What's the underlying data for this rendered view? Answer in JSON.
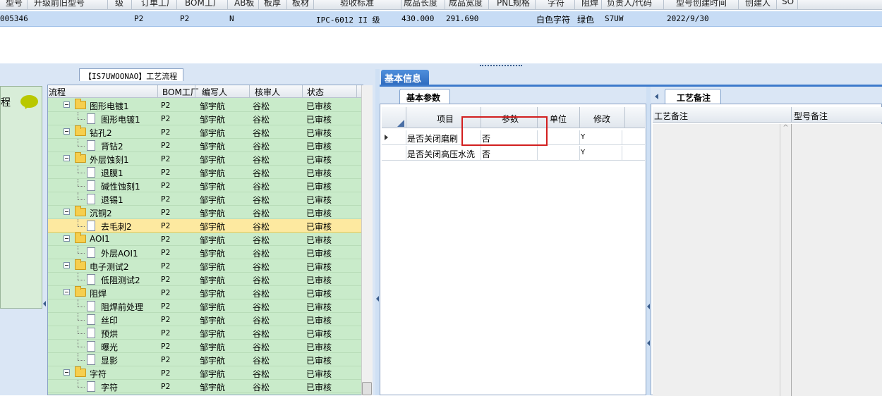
{
  "top_grid": {
    "columns": [
      "型号",
      "升级前旧型号",
      "级",
      "订单工厂",
      "BOM工厂",
      "AB板",
      "板厚",
      "板材",
      "验收标准",
      "成品长度",
      "成品宽度",
      "PNL规格",
      "字符",
      "阻焊",
      "负责人/代码",
      "型号创建时间",
      "创建人",
      "SO"
    ],
    "row": {
      "id": "005346",
      "order_factory": "P2",
      "bom_factory": "P2",
      "ab": "N",
      "standard": "IPC-6012 II 级",
      "length": "430.000",
      "width": "291.690",
      "char": "白色字符",
      "mask": "绿色",
      "code": "S7UW",
      "created": "2022/9/30"
    }
  },
  "left_panel": {
    "tab_title": "【IS7UWOONAO】工艺流程",
    "side_label": "程",
    "tree_columns": [
      "流程",
      "BOM工厂",
      "编写人",
      "核审人",
      "状态"
    ],
    "rows": [
      {
        "level": 0,
        "type": "folder",
        "name": "图形电镀1",
        "bom": "P2",
        "writer": "邹宇航",
        "reviewer": "谷松",
        "status": "已审核"
      },
      {
        "level": 1,
        "type": "doc",
        "name": "图形电镀1",
        "bom": "P2",
        "writer": "邹宇航",
        "reviewer": "谷松",
        "status": "已审核"
      },
      {
        "level": 0,
        "type": "folder",
        "name": "钻孔2",
        "bom": "P2",
        "writer": "邹宇航",
        "reviewer": "谷松",
        "status": "已审核"
      },
      {
        "level": 1,
        "type": "doc",
        "name": "背钻2",
        "bom": "P2",
        "writer": "邹宇航",
        "reviewer": "谷松",
        "status": "已审核"
      },
      {
        "level": 0,
        "type": "folder",
        "name": "外层蚀刻1",
        "bom": "P2",
        "writer": "邹宇航",
        "reviewer": "谷松",
        "status": "已审核"
      },
      {
        "level": 1,
        "type": "doc",
        "name": "退膜1",
        "bom": "P2",
        "writer": "邹宇航",
        "reviewer": "谷松",
        "status": "已审核"
      },
      {
        "level": 1,
        "type": "doc",
        "name": "碱性蚀刻1",
        "bom": "P2",
        "writer": "邹宇航",
        "reviewer": "谷松",
        "status": "已审核"
      },
      {
        "level": 1,
        "type": "doc",
        "name": "退锡1",
        "bom": "P2",
        "writer": "邹宇航",
        "reviewer": "谷松",
        "status": "已审核"
      },
      {
        "level": 0,
        "type": "folder",
        "name": "沉铜2",
        "bom": "P2",
        "writer": "邹宇航",
        "reviewer": "谷松",
        "status": "已审核"
      },
      {
        "level": 1,
        "type": "doc",
        "name": "去毛刺2",
        "bom": "P2",
        "writer": "邹宇航",
        "reviewer": "谷松",
        "status": "已审核",
        "selected": true
      },
      {
        "level": 0,
        "type": "folder",
        "name": "AOI1",
        "bom": "P2",
        "writer": "邹宇航",
        "reviewer": "谷松",
        "status": "已审核"
      },
      {
        "level": 1,
        "type": "doc",
        "name": "外层AOI1",
        "bom": "P2",
        "writer": "邹宇航",
        "reviewer": "谷松",
        "status": "已审核"
      },
      {
        "level": 0,
        "type": "folder",
        "name": "电子测试2",
        "bom": "P2",
        "writer": "邹宇航",
        "reviewer": "谷松",
        "status": "已审核"
      },
      {
        "level": 1,
        "type": "doc",
        "name": "低阻测试2",
        "bom": "P2",
        "writer": "邹宇航",
        "reviewer": "谷松",
        "status": "已审核"
      },
      {
        "level": 0,
        "type": "folder",
        "name": "阻焊",
        "bom": "P2",
        "writer": "邹宇航",
        "reviewer": "谷松",
        "status": "已审核"
      },
      {
        "level": 1,
        "type": "doc",
        "name": "阻焊前处理",
        "bom": "P2",
        "writer": "邹宇航",
        "reviewer": "谷松",
        "status": "已审核"
      },
      {
        "level": 1,
        "type": "doc",
        "name": "丝印",
        "bom": "P2",
        "writer": "邹宇航",
        "reviewer": "谷松",
        "status": "已审核"
      },
      {
        "level": 1,
        "type": "doc",
        "name": "预烘",
        "bom": "P2",
        "writer": "邹宇航",
        "reviewer": "谷松",
        "status": "已审核"
      },
      {
        "level": 1,
        "type": "doc",
        "name": "曝光",
        "bom": "P2",
        "writer": "邹宇航",
        "reviewer": "谷松",
        "status": "已审核"
      },
      {
        "level": 1,
        "type": "doc",
        "name": "显影",
        "bom": "P2",
        "writer": "邹宇航",
        "reviewer": "谷松",
        "status": "已审核"
      },
      {
        "level": 0,
        "type": "folder",
        "name": "字符",
        "bom": "P2",
        "writer": "邹宇航",
        "reviewer": "谷松",
        "status": "已审核"
      },
      {
        "level": 1,
        "type": "doc",
        "name": "字符",
        "bom": "P2",
        "writer": "邹宇航",
        "reviewer": "谷松",
        "status": "已审核"
      }
    ]
  },
  "right_panel": {
    "main_tab": "基本信息",
    "param_tab": "基本参数",
    "param_columns": [
      "项目",
      "参数",
      "单位",
      "修改"
    ],
    "param_rows": [
      {
        "item": "是否关闭磨刷",
        "value": "否",
        "unit": "",
        "modify": "Y"
      },
      {
        "item": "是否关闭高压水洗",
        "value": "否",
        "unit": "",
        "modify": "Y"
      }
    ],
    "note_tab": "工艺备注",
    "note_columns": [
      "工艺备注",
      "型号备注"
    ]
  },
  "colors": {
    "tree_bg": "#c9ebca",
    "selected_row": "#fde9a0",
    "accent_blue": "#2e6bbf",
    "highlight_box": "#d21f1f"
  }
}
